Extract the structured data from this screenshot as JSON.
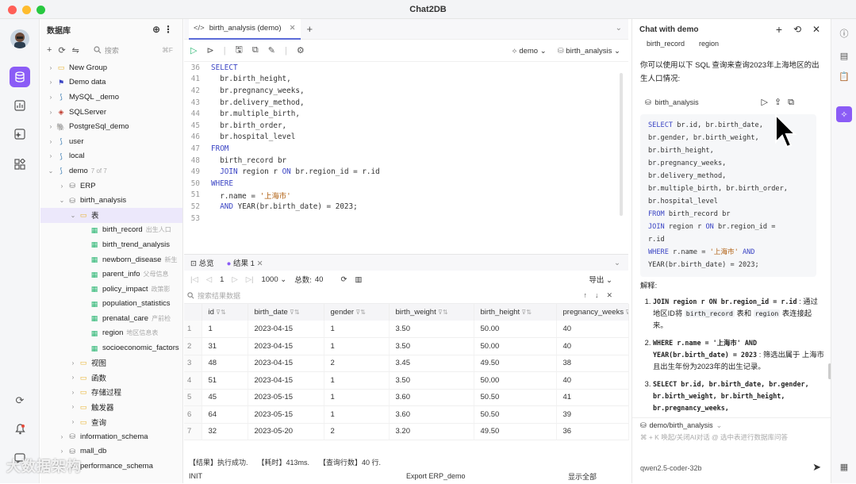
{
  "window": {
    "title": "Chat2DB"
  },
  "tree": {
    "header": "数据库",
    "search_placeholder": "搜索",
    "search_shortcut": "⌘F",
    "nodes": [
      {
        "label": "New Group",
        "level": 0,
        "icon": "folder-icon"
      },
      {
        "label": "Demo data",
        "level": 0,
        "icon": "flag-icon"
      },
      {
        "label": "MySQL _demo",
        "level": 0,
        "icon": "mysql-icon"
      },
      {
        "label": "SQLServer",
        "level": 0,
        "icon": "sqlserver-icon"
      },
      {
        "label": "PostgreSql_demo",
        "level": 0,
        "icon": "postgres-icon"
      },
      {
        "label": "user",
        "level": 0,
        "icon": "mysql-icon"
      },
      {
        "label": "local",
        "level": 0,
        "icon": "mysql-icon"
      },
      {
        "label": "demo",
        "level": 0,
        "icon": "mysql-icon",
        "sub": "7 of 7"
      },
      {
        "label": "ERP",
        "level": 1,
        "icon": "database-icon"
      },
      {
        "label": "birth_analysis",
        "level": 1,
        "icon": "database-icon"
      },
      {
        "label": "表",
        "level": 2,
        "icon": "folder-icon"
      },
      {
        "label": "birth_record",
        "level": 3,
        "icon": "table-icon",
        "sub": "出生人口"
      },
      {
        "label": "birth_trend_analysis",
        "level": 3,
        "icon": "table-icon"
      },
      {
        "label": "newborn_disease",
        "level": 3,
        "icon": "table-icon",
        "sub": "新生"
      },
      {
        "label": "parent_info",
        "level": 3,
        "icon": "table-icon",
        "sub": "父母信息"
      },
      {
        "label": "policy_impact",
        "level": 3,
        "icon": "table-icon",
        "sub": "政策影"
      },
      {
        "label": "population_statistics",
        "level": 3,
        "icon": "table-icon"
      },
      {
        "label": "prenatal_care",
        "level": 3,
        "icon": "table-icon",
        "sub": "产前检"
      },
      {
        "label": "region",
        "level": 3,
        "icon": "table-icon",
        "sub": "地区信息表"
      },
      {
        "label": "socioeconomic_factors",
        "level": 3,
        "icon": "table-icon"
      },
      {
        "label": "视图",
        "level": 2,
        "icon": "folder-icon"
      },
      {
        "label": "函数",
        "level": 2,
        "icon": "folder-icon"
      },
      {
        "label": "存储过程",
        "level": 2,
        "icon": "folder-icon"
      },
      {
        "label": "触发器",
        "level": 2,
        "icon": "folder-icon"
      },
      {
        "label": "查询",
        "level": 2,
        "icon": "folder-icon"
      },
      {
        "label": "information_schema",
        "level": 1,
        "icon": "database-icon"
      },
      {
        "label": "mall_db",
        "level": 1,
        "icon": "database-icon"
      },
      {
        "label": "performance_schema",
        "level": 1,
        "icon": "database-icon"
      }
    ]
  },
  "editor": {
    "tab_label": "birth_analysis (demo)",
    "connection": "demo",
    "database": "birth_analysis",
    "lines": [
      {
        "n": "36",
        "html": "<span class='kw'>SELECT</span>"
      },
      {
        "n": "41",
        "html": "  br.birth_height,"
      },
      {
        "n": "42",
        "html": "  br.pregnancy_weeks,"
      },
      {
        "n": "43",
        "html": "  br.delivery_method,"
      },
      {
        "n": "44",
        "html": "  br.multiple_birth,"
      },
      {
        "n": "45",
        "html": "  br.birth_order,"
      },
      {
        "n": "46",
        "html": "  br.hospital_level"
      },
      {
        "n": "47",
        "html": "<span class='kw'>FROM</span>"
      },
      {
        "n": "48",
        "html": "  birth_record br"
      },
      {
        "n": "49",
        "html": "  <span class='kw'>JOIN</span> region r <span class='kw'>ON</span> br.region_id = r.id"
      },
      {
        "n": "50",
        "html": "<span class='kw'>WHERE</span>"
      },
      {
        "n": "51",
        "html": "  r.name = <span class='str'>'上海市'</span>"
      },
      {
        "n": "52",
        "html": "  <span class='kw'>AND</span> YEAR(br.birth_date) = 2023;"
      },
      {
        "n": "53",
        "html": ""
      }
    ]
  },
  "results": {
    "tab_overview": "总览",
    "tab_result": "结果 1",
    "page": "1",
    "page_size": "1000",
    "total_label": "总数:",
    "total": "40",
    "export_label": "导出",
    "search_placeholder": "搜索结果数据",
    "columns": [
      "id",
      "birth_date",
      "gender",
      "birth_weight",
      "birth_height",
      "pregnancy_weeks"
    ],
    "rows": [
      [
        "1",
        "1",
        "2023-04-15",
        "1",
        "3.50",
        "50.00",
        "40"
      ],
      [
        "2",
        "31",
        "2023-04-15",
        "1",
        "3.50",
        "50.00",
        "40"
      ],
      [
        "3",
        "48",
        "2023-04-15",
        "2",
        "3.45",
        "49.50",
        "38"
      ],
      [
        "4",
        "51",
        "2023-04-15",
        "1",
        "3.50",
        "50.00",
        "40"
      ],
      [
        "5",
        "45",
        "2023-05-15",
        "1",
        "3.60",
        "50.50",
        "41"
      ],
      [
        "6",
        "64",
        "2023-05-15",
        "1",
        "3.60",
        "50.50",
        "39"
      ],
      [
        "7",
        "32",
        "2023-05-20",
        "2",
        "3.20",
        "49.50",
        "36"
      ]
    ],
    "status_success": "【结果】执行成功.",
    "status_time": "【耗时】413ms.",
    "status_rows": "【查询行数】40 行.",
    "footer_left": "INIT",
    "footer_mid": "Export ERP_demo",
    "footer_right": "显示全部"
  },
  "chat": {
    "title": "Chat with demo",
    "tags": [
      "birth_record",
      "region"
    ],
    "intro": "你可以使用以下 SQL 查询来查询2023年上海地区的出生人口情况:",
    "code_db": "birth_analysis",
    "code_lines": [
      "<span class='kw'>SELECT</span> br.id, br.birth_date,",
      "br.gender, br.birth_weight,",
      "br.birth_height,",
      "br.pregnancy_weeks,",
      "br.delivery_method,",
      "br.multiple_birth, br.birth_order,",
      "br.hospital_level",
      "<span class='kw'>FROM</span> birth_record br",
      "<span class='kw'>JOIN</span> region r <span class='kw'>ON</span> br.region_id =",
      "r.id",
      "<span class='kw'>WHERE</span> r.name = <span class='str'>'上海市'</span> <span class='kw'>AND</span>",
      "YEAR(br.birth_date) = 2023;"
    ],
    "explain_title": "解释:",
    "explain_items": [
      {
        "html": "<span class='mono'>JOIN region r ON br.region_id = r.id</span> : 通过地区ID将 <span class='chip'>birth_record</span> 表和 <span class='chip'>region</span> 表连接起来。"
      },
      {
        "html": "<span class='mono'>WHERE r.name = '上海市' AND YEAR(br.birth_date) = 2023</span> : 筛选出属于 上海市 且出生年份为2023年的出生记录。"
      },
      {
        "html": "<span class='mono'>SELECT br.id, br.birth_date, br.gender, br.birth_weight, br.birth_height, br.pregnancy_weeks,</span>"
      }
    ],
    "input_context": "demo/birth_analysis",
    "input_placeholder": "⌘ + K 唤起/关闭AI对话 @ 选中表进行数据库问答",
    "model": "qwen2.5-coder-32b"
  },
  "colors": {
    "accent": "#8b5cf6",
    "keyword": "#3b45c4",
    "string": "#b05e0e"
  },
  "watermark": "大数据架构"
}
